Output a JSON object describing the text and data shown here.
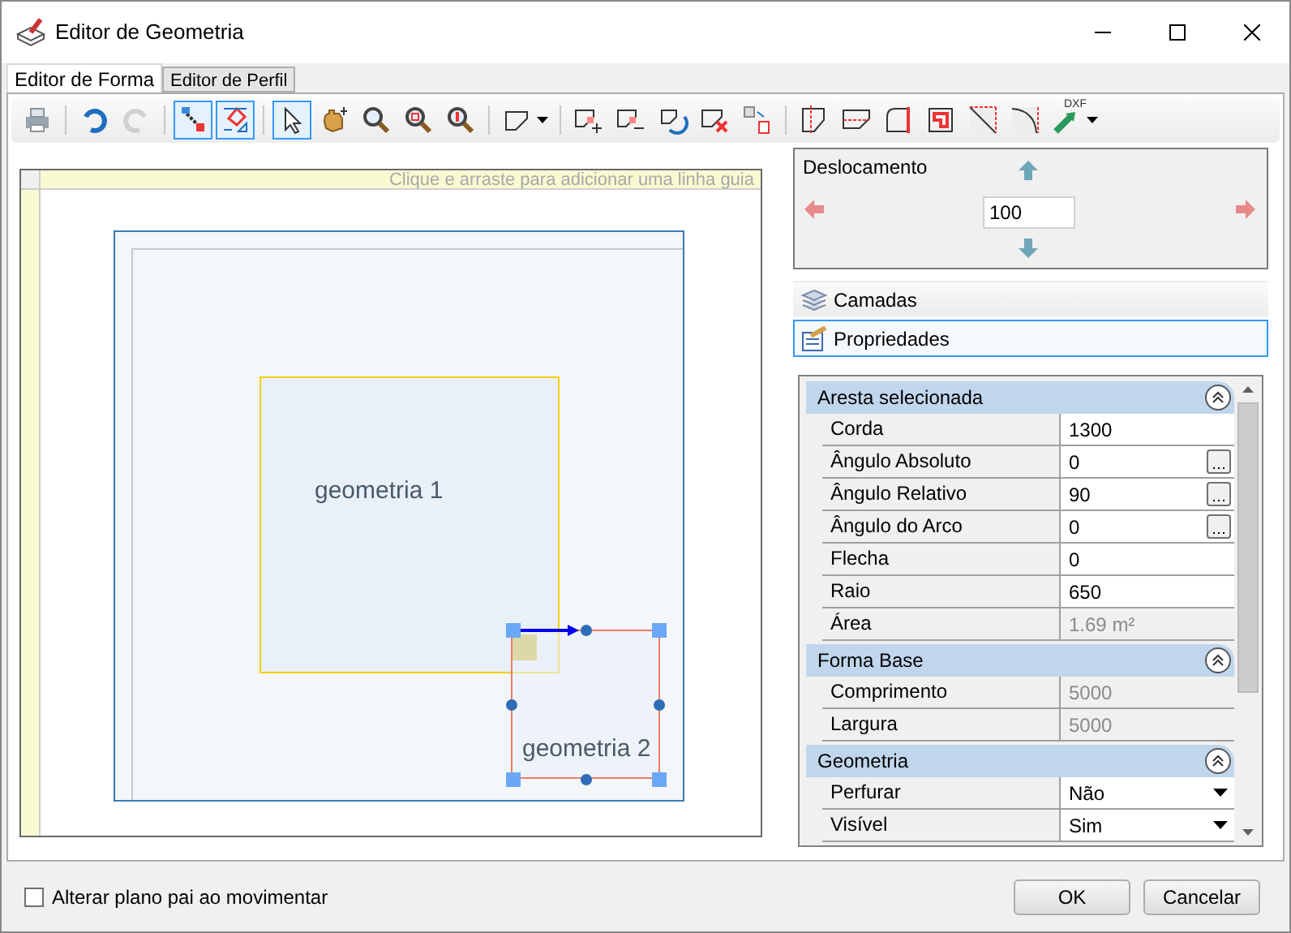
{
  "window": {
    "title": "Editor de Geometria"
  },
  "tabs": [
    {
      "label": "Editor de Forma",
      "selected": true
    },
    {
      "label": "Editor de Perfil",
      "selected": false
    }
  ],
  "toolbar": [
    {
      "kind": "button",
      "active": false,
      "disabled": false
    },
    {
      "kind": "separator"
    },
    {
      "kind": "button",
      "active": false,
      "disabled": false
    },
    {
      "kind": "button",
      "active": false,
      "disabled": true
    },
    {
      "kind": "separator"
    },
    {
      "kind": "button",
      "active": true,
      "disabled": false
    },
    {
      "kind": "button",
      "active": true,
      "disabled": false
    },
    {
      "kind": "separator"
    },
    {
      "kind": "button",
      "active": true,
      "disabled": false
    },
    {
      "kind": "button",
      "active": false,
      "disabled": false
    },
    {
      "kind": "button",
      "active": false,
      "disabled": false
    },
    {
      "kind": "button",
      "active": false,
      "disabled": false
    },
    {
      "kind": "button",
      "active": false,
      "disabled": false
    },
    {
      "kind": "separator"
    },
    {
      "kind": "dropdown",
      "active": false,
      "disabled": false
    },
    {
      "kind": "separator"
    },
    {
      "kind": "button",
      "active": false,
      "disabled": false
    },
    {
      "kind": "button",
      "active": false,
      "disabled": false
    },
    {
      "kind": "button",
      "active": false,
      "disabled": false
    },
    {
      "kind": "button",
      "active": false,
      "disabled": false
    },
    {
      "kind": "button",
      "active": false,
      "disabled": false
    },
    {
      "kind": "separator"
    },
    {
      "kind": "button",
      "active": false,
      "disabled": false
    },
    {
      "kind": "button",
      "active": false,
      "disabled": false
    },
    {
      "kind": "button",
      "active": false,
      "disabled": false
    },
    {
      "kind": "button",
      "active": false,
      "disabled": false
    },
    {
      "kind": "button",
      "active": false,
      "disabled": false
    },
    {
      "kind": "button",
      "active": false,
      "disabled": false
    },
    {
      "kind": "dropdown",
      "active": false,
      "disabled": false,
      "badge": "DXF"
    }
  ],
  "canvas": {
    "hint": "Clique e arraste para adicionar uma linha guia",
    "geometries": [
      {
        "label": "geometria 1",
        "selected": false
      },
      {
        "label": "geometria 2",
        "selected": true
      }
    ]
  },
  "offset": {
    "title": "Deslocamento",
    "value": "100"
  },
  "panels": [
    {
      "label": "Camadas",
      "selected": false
    },
    {
      "label": "Propriedades",
      "selected": true
    }
  ],
  "property_grid": [
    {
      "title": "Aresta selecionada",
      "expanded": true,
      "rows": [
        {
          "label": "Corda",
          "value": "1300",
          "kind": "text",
          "disabled": false
        },
        {
          "label": "Ângulo Absoluto",
          "value": "0",
          "kind": "ellipsis",
          "disabled": false
        },
        {
          "label": "Ângulo Relativo",
          "value": "90",
          "kind": "ellipsis",
          "disabled": false
        },
        {
          "label": "Ângulo do Arco",
          "value": "0",
          "kind": "ellipsis",
          "disabled": false
        },
        {
          "label": "Flecha",
          "value": "0",
          "kind": "text",
          "disabled": false
        },
        {
          "label": "Raio",
          "value": "650",
          "kind": "text",
          "disabled": false
        },
        {
          "label": "Área",
          "value": "1.69 m²",
          "kind": "text",
          "disabled": true
        }
      ]
    },
    {
      "title": "Forma Base",
      "expanded": true,
      "rows": [
        {
          "label": "Comprimento",
          "value": "5000",
          "kind": "text",
          "disabled": true
        },
        {
          "label": "Largura",
          "value": "5000",
          "kind": "text",
          "disabled": true
        }
      ]
    },
    {
      "title": "Geometria",
      "expanded": true,
      "rows": [
        {
          "label": "Perfurar",
          "value": "Não",
          "kind": "dropdown",
          "disabled": false
        },
        {
          "label": "Visível",
          "value": "Sim",
          "kind": "dropdown",
          "disabled": false
        }
      ]
    }
  ],
  "footer": {
    "checkbox": {
      "label": "Alterar plano pai ao movimentar",
      "checked": false
    },
    "buttons": [
      "OK",
      "Cancelar"
    ]
  }
}
